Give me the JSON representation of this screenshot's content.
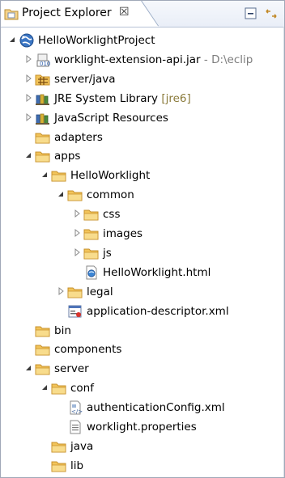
{
  "view": {
    "title": "Project Explorer",
    "close_glyph": "☒"
  },
  "toolbar": {
    "collapse_icon": "collapse-all-icon",
    "link_icon": "link-with-editor-icon"
  },
  "tree": [
    {
      "label": "HelloWorklightProject",
      "level": 0,
      "toggle": "expanded",
      "icon": "project-icon"
    },
    {
      "label": "worklight-extension-api.jar",
      "suffix": " - D:\\eclip",
      "level": 1,
      "toggle": "collapsed",
      "icon": "jar-icon"
    },
    {
      "label": "server/java",
      "level": 1,
      "toggle": "collapsed",
      "icon": "source-folder-icon"
    },
    {
      "label": "JRE System Library",
      "suffix": " [jre6]",
      "level": 1,
      "toggle": "collapsed",
      "icon": "library-icon"
    },
    {
      "label": "JavaScript Resources",
      "level": 1,
      "toggle": "collapsed",
      "icon": "library-icon"
    },
    {
      "label": "adapters",
      "level": 1,
      "toggle": "none",
      "icon": "folder-icon"
    },
    {
      "label": "apps",
      "level": 1,
      "toggle": "expanded",
      "icon": "folder-icon"
    },
    {
      "label": "HelloWorklight",
      "level": 2,
      "toggle": "expanded",
      "icon": "folder-icon"
    },
    {
      "label": "common",
      "level": 3,
      "toggle": "expanded",
      "icon": "folder-icon"
    },
    {
      "label": "css",
      "level": 4,
      "toggle": "collapsed",
      "icon": "folder-icon"
    },
    {
      "label": "images",
      "level": 4,
      "toggle": "collapsed",
      "icon": "folder-icon"
    },
    {
      "label": "js",
      "level": 4,
      "toggle": "collapsed",
      "icon": "folder-icon"
    },
    {
      "label": "HelloWorklight.html",
      "level": 4,
      "toggle": "none",
      "icon": "html-file-icon"
    },
    {
      "label": "legal",
      "level": 3,
      "toggle": "collapsed",
      "icon": "folder-icon"
    },
    {
      "label": "application-descriptor.xml",
      "level": 3,
      "toggle": "none",
      "icon": "xml-descriptor-icon"
    },
    {
      "label": "bin",
      "level": 1,
      "toggle": "none",
      "icon": "folder-icon"
    },
    {
      "label": "components",
      "level": 1,
      "toggle": "none",
      "icon": "folder-icon"
    },
    {
      "label": "server",
      "level": 1,
      "toggle": "expanded",
      "icon": "folder-icon"
    },
    {
      "label": "conf",
      "level": 2,
      "toggle": "expanded",
      "icon": "folder-icon"
    },
    {
      "label": "authenticationConfig.xml",
      "level": 3,
      "toggle": "none",
      "icon": "xml-config-icon"
    },
    {
      "label": "worklight.properties",
      "level": 3,
      "toggle": "none",
      "icon": "properties-file-icon"
    },
    {
      "label": "java",
      "level": 2,
      "toggle": "none",
      "icon": "folder-icon"
    },
    {
      "label": "lib",
      "level": 2,
      "toggle": "none",
      "icon": "folder-icon"
    }
  ],
  "colors": {
    "folder": "#f2c45a",
    "folder_dark": "#c7902b",
    "toggle": "#6a6a6a",
    "suffix": "#8a7a3a"
  }
}
